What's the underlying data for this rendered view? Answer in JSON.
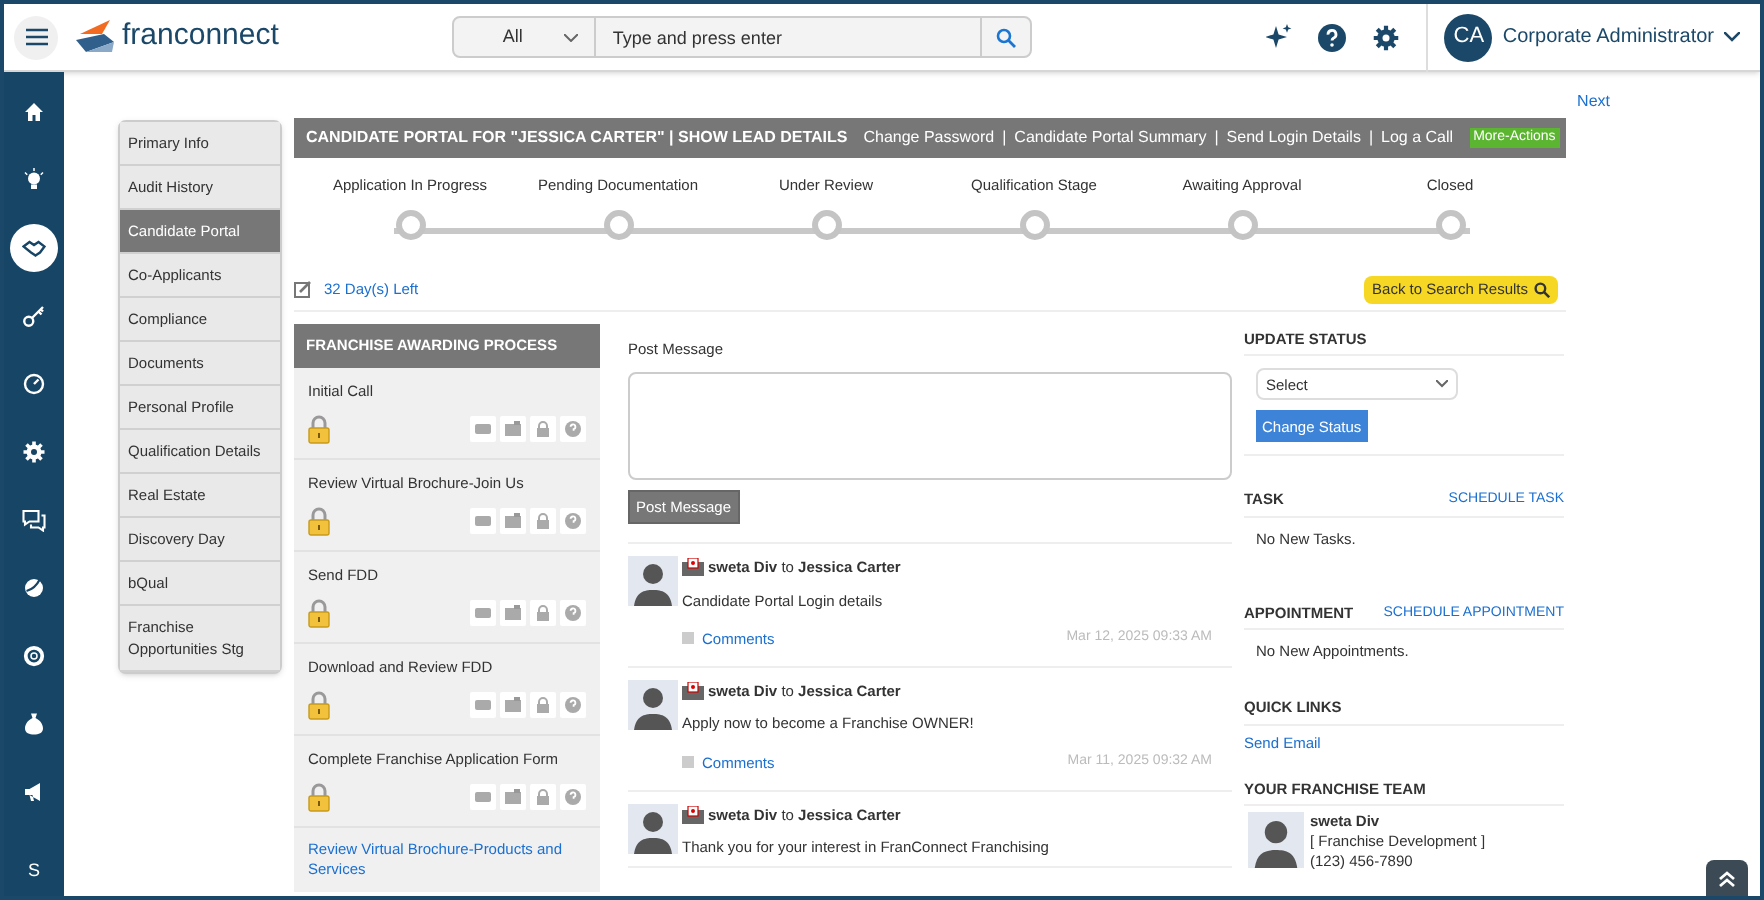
{
  "top_bar": {
    "brand": "franconnect",
    "search_scope": "All",
    "search": {
      "placeholder": "Type and press enter"
    },
    "user": {
      "initials": "CA",
      "name": "Corporate Administrator"
    }
  },
  "sidebar": [
    {
      "kind": "home",
      "selected": false
    },
    {
      "kind": "bulb",
      "selected": false
    },
    {
      "kind": "handshake",
      "selected": true
    },
    {
      "kind": "key",
      "selected": false
    },
    {
      "kind": "gauge",
      "selected": false
    },
    {
      "kind": "gear",
      "selected": false
    },
    {
      "kind": "chat",
      "selected": false
    },
    {
      "kind": "globe",
      "selected": false
    },
    {
      "kind": "lifebuoy",
      "selected": false
    },
    {
      "kind": "moneybag",
      "selected": false
    },
    {
      "kind": "megaphone",
      "selected": false
    },
    {
      "kind": "letter",
      "label": "S",
      "selected": false
    }
  ],
  "next_link": "Next",
  "tabs": [
    {
      "label": "Primary Info",
      "selected": false
    },
    {
      "label": "Audit History",
      "selected": false
    },
    {
      "label": "Candidate Portal",
      "selected": true
    },
    {
      "label": "Co-Applicants",
      "selected": false
    },
    {
      "label": "Compliance",
      "selected": false
    },
    {
      "label": "Documents",
      "selected": false
    },
    {
      "label": "Personal Profile",
      "selected": false
    },
    {
      "label": "Qualification Details",
      "selected": false
    },
    {
      "label": "Real Estate",
      "selected": false
    },
    {
      "label": "Discovery Day",
      "selected": false
    },
    {
      "label": "bQual",
      "selected": false
    },
    {
      "label": "Franchise Opportunities Stg",
      "selected": false
    }
  ],
  "portal_header": {
    "title": "CANDIDATE PORTAL FOR \"JESSICA CARTER\" | SHOW LEAD DETAILS",
    "separator": "|",
    "actions": [
      "Change Password",
      "Candidate Portal Summary",
      "Send Login Details",
      "Log a Call"
    ],
    "more_actions": "More-Actions"
  },
  "stages": [
    "Application In Progress",
    "Pending Documentation",
    "Under Review",
    "Qualification Stage",
    "Awaiting Approval",
    "Closed"
  ],
  "days_left": "32 Day(s) Left",
  "back_button": "Back to Search Results",
  "process": {
    "title": "FRANCHISE AWARDING PROCESS",
    "steps": [
      {
        "kind": "locked",
        "label": "Initial Call"
      },
      {
        "kind": "locked",
        "label": "Review Virtual Brochure-Join Us"
      },
      {
        "kind": "locked",
        "label": "Send FDD"
      },
      {
        "kind": "locked",
        "label": "Download and Review FDD"
      },
      {
        "kind": "locked",
        "label": "Complete Franchise Application Form"
      },
      {
        "kind": "link",
        "label": "Review Virtual Brochure-Products and Services"
      }
    ]
  },
  "post": {
    "label": "Post Message",
    "button": "Post Message"
  },
  "messages": [
    {
      "header": "**sweta Div** to **Jessica Carter**",
      "text": "Candidate Portal Login details",
      "comments": "Comments",
      "time": "Mar 12, 2025 09:33 AM"
    },
    {
      "header": "**sweta Div** to **Jessica Carter**",
      "text": "Apply now to become a Franchise OWNER!",
      "comments": "Comments",
      "time": "Mar 11, 2025 09:32 AM"
    },
    {
      "header": "**sweta Div** to **Jessica Carter**",
      "text": "Thank you for your interest in FranConnect Franchising"
    }
  ],
  "update_status": {
    "title": "UPDATE STATUS",
    "select": "Select",
    "button": "Change Status"
  },
  "task": {
    "title": "TASK",
    "action": "SCHEDULE TASK",
    "empty": "No New Tasks."
  },
  "appointment": {
    "title": "APPOINTMENT",
    "action": "SCHEDULE APPOINTMENT",
    "empty": "No New Appointments."
  },
  "quick_links": {
    "title": "QUICK LINKS",
    "links": [
      "Send Email"
    ]
  },
  "team": {
    "title": "YOUR FRANCHISE TEAM",
    "members": [
      {
        "name": "sweta Div",
        "role": "[ Franchise Development ]",
        "phone": "(123) 456-7890"
      }
    ]
  }
}
